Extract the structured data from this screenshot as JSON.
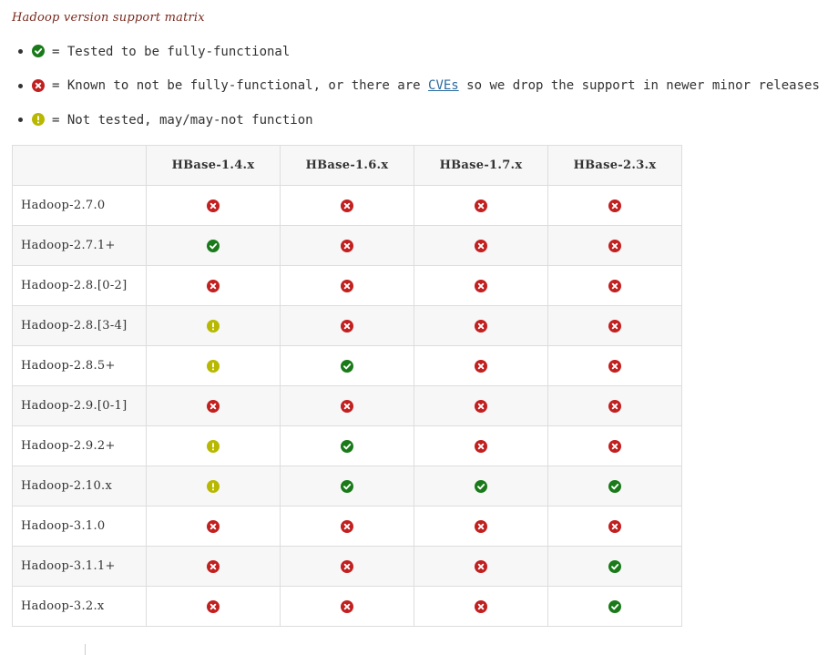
{
  "caption": "Hadoop version support matrix",
  "legend": [
    {
      "status": "yes",
      "text": "= Tested to be fully-functional"
    },
    {
      "status": "no",
      "text": "= Known to not be fully-functional, or there are ",
      "link": "CVEs",
      "suffix": " so we drop the support in newer minor releases"
    },
    {
      "status": "maybe",
      "text": "= Not tested, may/may-not function"
    }
  ],
  "icons": {
    "yes": {
      "name": "check-circle-icon",
      "color": "#1a7a1a"
    },
    "no": {
      "name": "x-circle-icon",
      "color": "#c21f1f"
    },
    "maybe": {
      "name": "exclamation-circle-icon",
      "color": "#b8b800"
    }
  },
  "table": {
    "columns": [
      "HBase-1.4.x",
      "HBase-1.6.x",
      "HBase-1.7.x",
      "HBase-2.3.x"
    ],
    "rows": [
      {
        "label": "Hadoop-2.7.0",
        "cells": [
          "no",
          "no",
          "no",
          "no"
        ]
      },
      {
        "label": "Hadoop-2.7.1+",
        "cells": [
          "yes",
          "no",
          "no",
          "no"
        ]
      },
      {
        "label": "Hadoop-2.8.[0-2]",
        "cells": [
          "no",
          "no",
          "no",
          "no"
        ]
      },
      {
        "label": "Hadoop-2.8.[3-4]",
        "cells": [
          "maybe",
          "no",
          "no",
          "no"
        ]
      },
      {
        "label": "Hadoop-2.8.5+",
        "cells": [
          "maybe",
          "yes",
          "no",
          "no"
        ]
      },
      {
        "label": "Hadoop-2.9.[0-1]",
        "cells": [
          "no",
          "no",
          "no",
          "no"
        ]
      },
      {
        "label": "Hadoop-2.9.2+",
        "cells": [
          "maybe",
          "yes",
          "no",
          "no"
        ]
      },
      {
        "label": "Hadoop-2.10.x",
        "cells": [
          "maybe",
          "yes",
          "yes",
          "yes"
        ]
      },
      {
        "label": "Hadoop-3.1.0",
        "cells": [
          "no",
          "no",
          "no",
          "no"
        ]
      },
      {
        "label": "Hadoop-3.1.1+",
        "cells": [
          "no",
          "no",
          "no",
          "yes"
        ]
      },
      {
        "label": "Hadoop-3.2.x",
        "cells": [
          "no",
          "no",
          "no",
          "yes"
        ]
      }
    ]
  }
}
